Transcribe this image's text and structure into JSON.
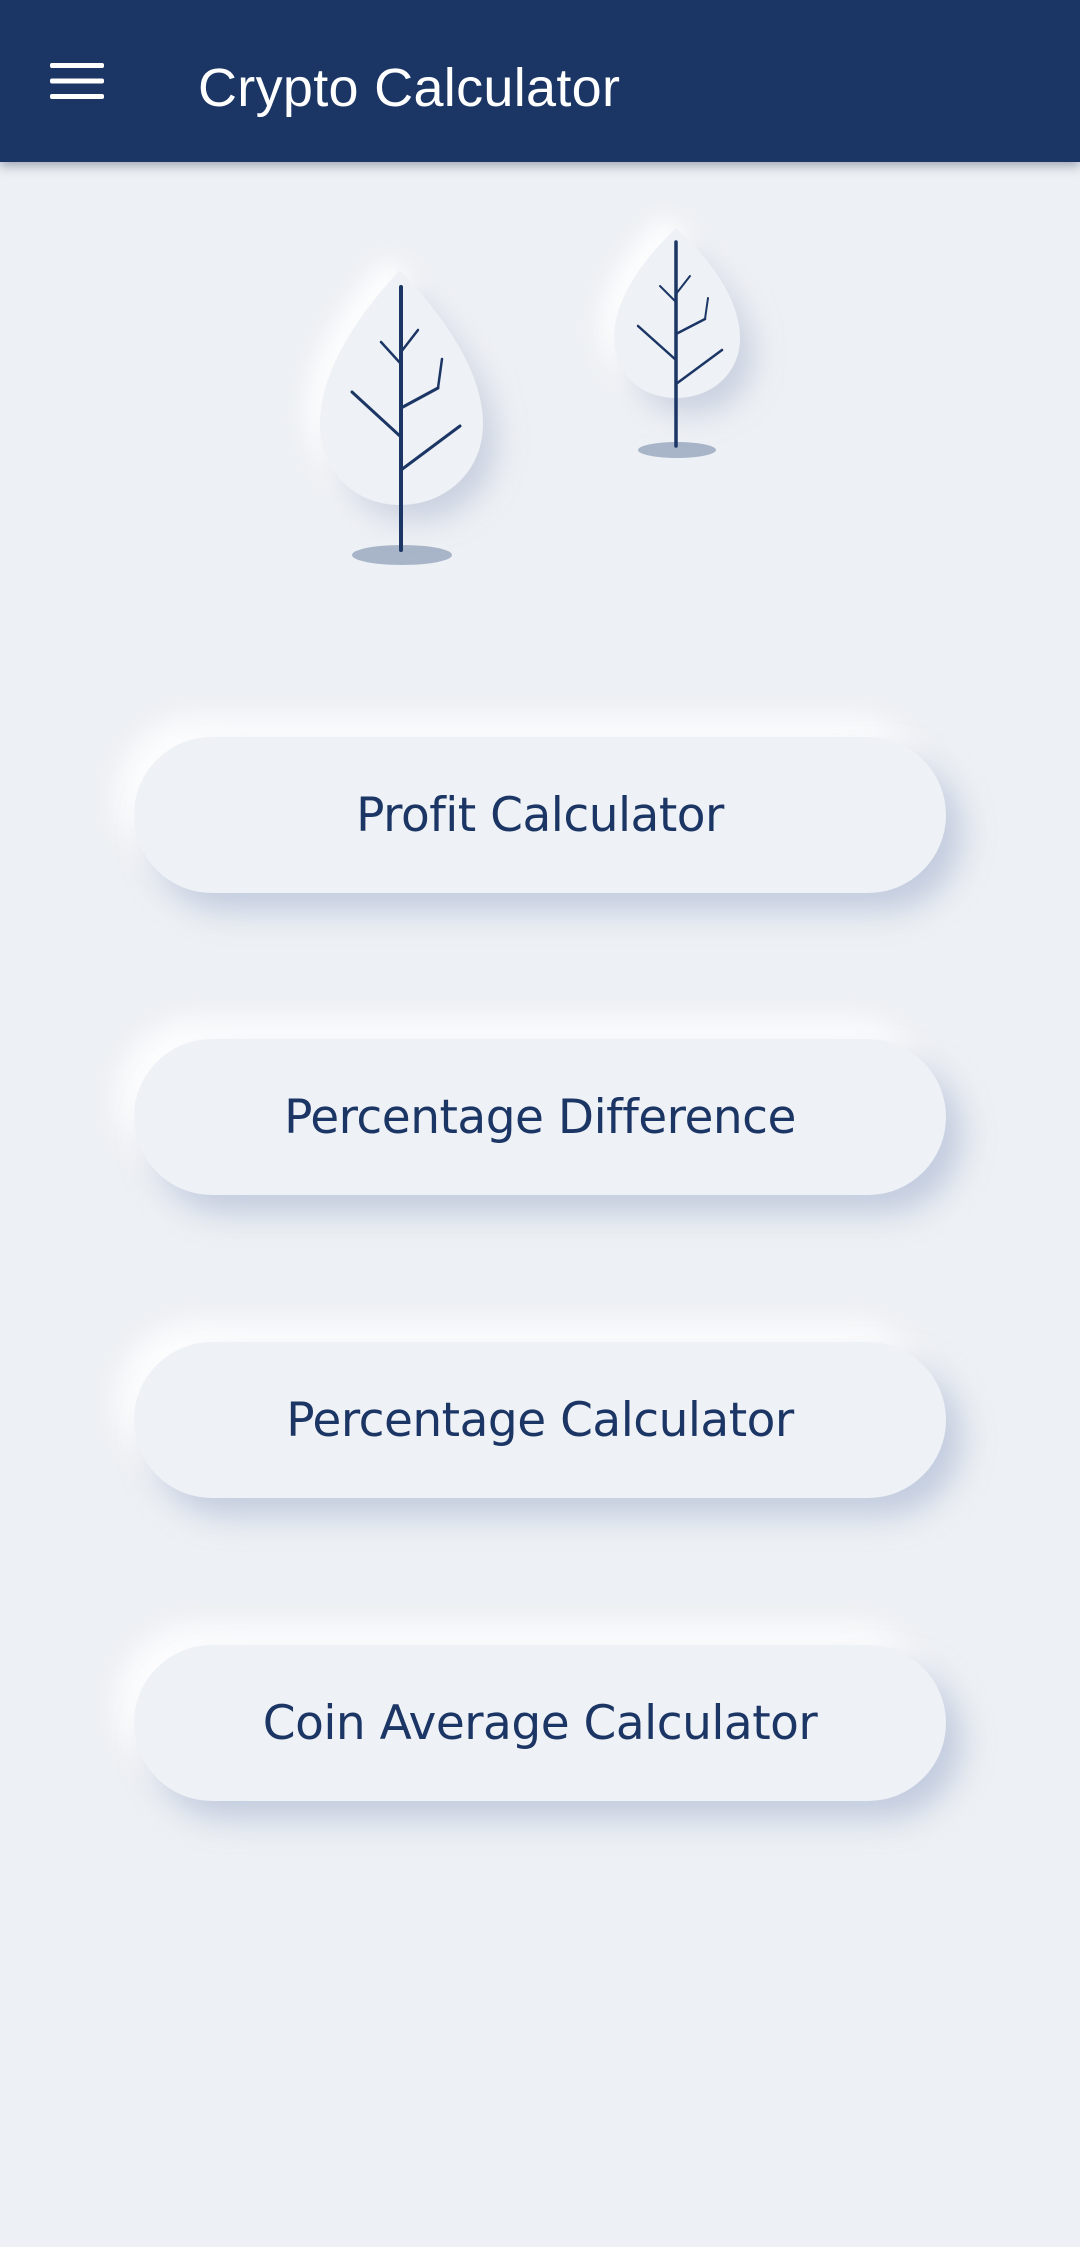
{
  "app_bar": {
    "title": "Crypto Calculator",
    "menu_icon": "hamburger-menu-icon",
    "background_color": "#1b3565",
    "title_color": "#ffffff"
  },
  "illustration": {
    "icons": [
      "tree-icon",
      "tree-icon"
    ]
  },
  "buttons": [
    {
      "label": "Profit Calculator"
    },
    {
      "label": "Percentage Difference"
    },
    {
      "label": "Percentage Calculator"
    },
    {
      "label": "Coin Average Calculator"
    }
  ],
  "colors": {
    "accent": "#1b3565",
    "background": "#edf0f4",
    "button_surface": "#eef1f5"
  }
}
